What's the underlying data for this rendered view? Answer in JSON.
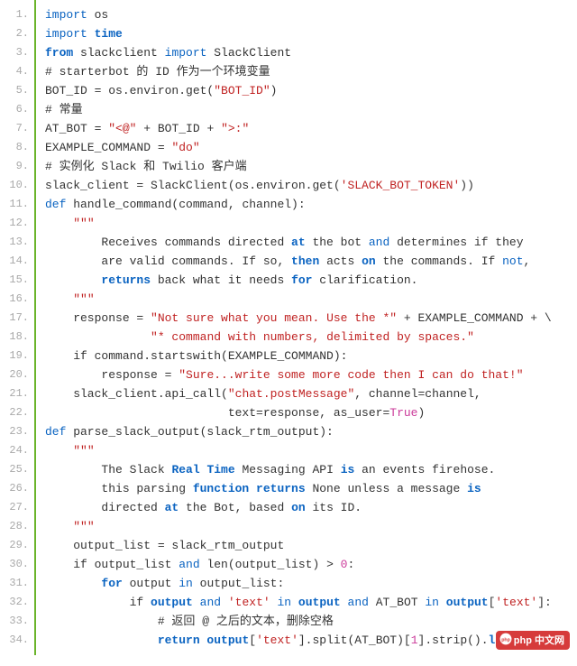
{
  "watermark": "php 中文网",
  "gutter": [
    "1.",
    "2.",
    "3.",
    "4.",
    "5.",
    "6.",
    "7.",
    "8.",
    "9.",
    "10.",
    "11.",
    "12.",
    "13.",
    "14.",
    "15.",
    "16.",
    "17.",
    "18.",
    "19.",
    "20.",
    "21.",
    "22.",
    "23.",
    "24.",
    "25.",
    "26.",
    "27.",
    "28.",
    "29.",
    "30.",
    "31.",
    "32.",
    "33.",
    "34."
  ],
  "lines": [
    {
      "tokens": [
        {
          "t": "kw",
          "v": "import"
        },
        {
          "t": "pln",
          "v": " os"
        }
      ]
    },
    {
      "tokens": [
        {
          "t": "kw",
          "v": "import"
        },
        {
          "t": "pln",
          "v": " "
        },
        {
          "t": "kwb",
          "v": "time"
        }
      ]
    },
    {
      "tokens": [
        {
          "t": "kwb",
          "v": "from"
        },
        {
          "t": "pln",
          "v": " slackclient "
        },
        {
          "t": "kw",
          "v": "import"
        },
        {
          "t": "pln",
          "v": " SlackClient"
        }
      ]
    },
    {
      "tokens": [
        {
          "t": "pln",
          "v": "# starterbot 的 ID 作为一个环境变量"
        }
      ]
    },
    {
      "tokens": [
        {
          "t": "pln",
          "v": "BOT_ID = os.environ.get("
        },
        {
          "t": "str",
          "v": "\"BOT_ID\""
        },
        {
          "t": "pln",
          "v": ")"
        }
      ]
    },
    {
      "tokens": [
        {
          "t": "pln",
          "v": "# 常量"
        }
      ]
    },
    {
      "tokens": [
        {
          "t": "pln",
          "v": "AT_BOT = "
        },
        {
          "t": "str",
          "v": "\"<@\""
        },
        {
          "t": "pln",
          "v": " + BOT_ID + "
        },
        {
          "t": "str",
          "v": "\">:\""
        }
      ]
    },
    {
      "tokens": [
        {
          "t": "pln",
          "v": "EXAMPLE_COMMAND = "
        },
        {
          "t": "str",
          "v": "\"do\""
        }
      ]
    },
    {
      "tokens": [
        {
          "t": "pln",
          "v": "# 实例化 Slack 和 Twilio 客户端"
        }
      ]
    },
    {
      "tokens": [
        {
          "t": "pln",
          "v": "slack_client = SlackClient(os.environ.get("
        },
        {
          "t": "str",
          "v": "'SLACK_BOT_TOKEN'"
        },
        {
          "t": "pln",
          "v": "))"
        }
      ]
    },
    {
      "tokens": [
        {
          "t": "kw",
          "v": "def"
        },
        {
          "t": "pln",
          "v": " handle_command(command, channel):"
        }
      ]
    },
    {
      "tokens": [
        {
          "t": "pln",
          "v": "    "
        },
        {
          "t": "str",
          "v": "\"\"\""
        }
      ]
    },
    {
      "tokens": [
        {
          "t": "pln",
          "v": "        Receives commands directed "
        },
        {
          "t": "kwb",
          "v": "at"
        },
        {
          "t": "pln",
          "v": " the bot "
        },
        {
          "t": "kw",
          "v": "and"
        },
        {
          "t": "pln",
          "v": " determines if they"
        }
      ]
    },
    {
      "tokens": [
        {
          "t": "pln",
          "v": "        are valid commands. If so, "
        },
        {
          "t": "kwb",
          "v": "then"
        },
        {
          "t": "pln",
          "v": " acts "
        },
        {
          "t": "kwb",
          "v": "on"
        },
        {
          "t": "pln",
          "v": " the commands. If "
        },
        {
          "t": "kw",
          "v": "not"
        },
        {
          "t": "pln",
          "v": ","
        }
      ]
    },
    {
      "tokens": [
        {
          "t": "pln",
          "v": "        "
        },
        {
          "t": "kwb",
          "v": "returns"
        },
        {
          "t": "pln",
          "v": " back what it needs "
        },
        {
          "t": "kwb",
          "v": "for"
        },
        {
          "t": "pln",
          "v": " clarification."
        }
      ]
    },
    {
      "tokens": [
        {
          "t": "pln",
          "v": "    "
        },
        {
          "t": "str",
          "v": "\"\"\""
        }
      ]
    },
    {
      "tokens": [
        {
          "t": "pln",
          "v": "    response = "
        },
        {
          "t": "str",
          "v": "\"Not sure what you mean. Use the *\""
        },
        {
          "t": "pln",
          "v": " + EXAMPLE_COMMAND + \\"
        }
      ]
    },
    {
      "tokens": [
        {
          "t": "pln",
          "v": "               "
        },
        {
          "t": "str",
          "v": "\"* command with numbers, delimited by spaces.\""
        }
      ]
    },
    {
      "tokens": [
        {
          "t": "pln",
          "v": "    if command.startswith(EXAMPLE_COMMAND):"
        }
      ]
    },
    {
      "tokens": [
        {
          "t": "pln",
          "v": "        response = "
        },
        {
          "t": "str",
          "v": "\"Sure...write some more code then I can do that!\""
        }
      ]
    },
    {
      "tokens": [
        {
          "t": "pln",
          "v": "    slack_client.api_call("
        },
        {
          "t": "str",
          "v": "\"chat.postMessage\""
        },
        {
          "t": "pln",
          "v": ", channel=channel,"
        }
      ]
    },
    {
      "tokens": [
        {
          "t": "pln",
          "v": "                          text=response, as_user="
        },
        {
          "t": "lit",
          "v": "True"
        },
        {
          "t": "pln",
          "v": ")"
        }
      ]
    },
    {
      "tokens": [
        {
          "t": "kw",
          "v": "def"
        },
        {
          "t": "pln",
          "v": " parse_slack_output(slack_rtm_output):"
        }
      ]
    },
    {
      "tokens": [
        {
          "t": "pln",
          "v": "    "
        },
        {
          "t": "str",
          "v": "\"\"\""
        }
      ]
    },
    {
      "tokens": [
        {
          "t": "pln",
          "v": "        The Slack "
        },
        {
          "t": "kwb",
          "v": "Real Time"
        },
        {
          "t": "pln",
          "v": " Messaging API "
        },
        {
          "t": "kwb",
          "v": "is"
        },
        {
          "t": "pln",
          "v": " an events firehose."
        }
      ]
    },
    {
      "tokens": [
        {
          "t": "pln",
          "v": "        this parsing "
        },
        {
          "t": "kwb",
          "v": "function returns"
        },
        {
          "t": "pln",
          "v": " None unless a message "
        },
        {
          "t": "kwb",
          "v": "is"
        }
      ]
    },
    {
      "tokens": [
        {
          "t": "pln",
          "v": "        directed "
        },
        {
          "t": "kwb",
          "v": "at"
        },
        {
          "t": "pln",
          "v": " the Bot, based "
        },
        {
          "t": "kwb",
          "v": "on"
        },
        {
          "t": "pln",
          "v": " its ID."
        }
      ]
    },
    {
      "tokens": [
        {
          "t": "pln",
          "v": "    "
        },
        {
          "t": "str",
          "v": "\"\"\""
        }
      ]
    },
    {
      "tokens": [
        {
          "t": "pln",
          "v": "    output_list = slack_rtm_output"
        }
      ]
    },
    {
      "tokens": [
        {
          "t": "pln",
          "v": "    if output_list "
        },
        {
          "t": "kw",
          "v": "and"
        },
        {
          "t": "pln",
          "v": " len(output_list) > "
        },
        {
          "t": "lit",
          "v": "0"
        },
        {
          "t": "pln",
          "v": ":"
        }
      ]
    },
    {
      "tokens": [
        {
          "t": "pln",
          "v": "        "
        },
        {
          "t": "kwb",
          "v": "for"
        },
        {
          "t": "pln",
          "v": " output "
        },
        {
          "t": "kw",
          "v": "in"
        },
        {
          "t": "pln",
          "v": " output_list:"
        }
      ]
    },
    {
      "tokens": [
        {
          "t": "pln",
          "v": "            if "
        },
        {
          "t": "kwb",
          "v": "output"
        },
        {
          "t": "pln",
          "v": " "
        },
        {
          "t": "kw",
          "v": "and"
        },
        {
          "t": "pln",
          "v": " "
        },
        {
          "t": "str",
          "v": "'text'"
        },
        {
          "t": "pln",
          "v": " "
        },
        {
          "t": "kw",
          "v": "in"
        },
        {
          "t": "pln",
          "v": " "
        },
        {
          "t": "kwb",
          "v": "output"
        },
        {
          "t": "pln",
          "v": " "
        },
        {
          "t": "kw",
          "v": "and"
        },
        {
          "t": "pln",
          "v": " AT_BOT "
        },
        {
          "t": "kw",
          "v": "in"
        },
        {
          "t": "pln",
          "v": " "
        },
        {
          "t": "kwb",
          "v": "output"
        },
        {
          "t": "pln",
          "v": "["
        },
        {
          "t": "str",
          "v": "'text'"
        },
        {
          "t": "pln",
          "v": "]:"
        }
      ]
    },
    {
      "tokens": [
        {
          "t": "pln",
          "v": "                # 返回 @ 之后的文本，删除空格"
        }
      ]
    },
    {
      "tokens": [
        {
          "t": "pln",
          "v": "                "
        },
        {
          "t": "kwb",
          "v": "return output"
        },
        {
          "t": "pln",
          "v": "["
        },
        {
          "t": "str",
          "v": "'text'"
        },
        {
          "t": "pln",
          "v": "].split(AT_BOT)["
        },
        {
          "t": "lit",
          "v": "1"
        },
        {
          "t": "pln",
          "v": "].strip()."
        },
        {
          "t": "kwb",
          "v": "lower"
        },
        {
          "t": "pln",
          "v": "(), \\"
        }
      ]
    }
  ]
}
